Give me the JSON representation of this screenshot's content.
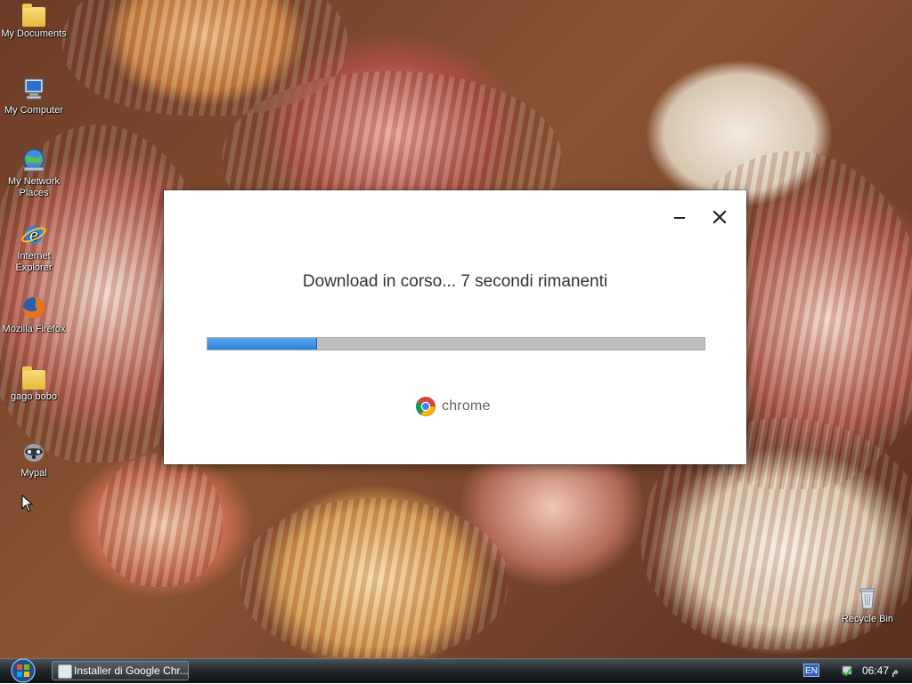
{
  "desktop": {
    "icons": [
      {
        "label": "My Documents",
        "icon": "folder-documents-icon"
      },
      {
        "label": "My Computer",
        "icon": "computer-icon"
      },
      {
        "label": "My Network Places",
        "icon": "network-globe-icon"
      },
      {
        "label": "Internet Explorer",
        "icon": "internet-explorer-icon"
      },
      {
        "label": "Mozilla Firefox",
        "icon": "firefox-icon"
      },
      {
        "label": "gago bobo",
        "icon": "folder-icon"
      },
      {
        "label": "Mypal",
        "icon": "mypal-raccoon-icon"
      },
      {
        "label": "Recycle Bin",
        "icon": "recycle-bin-icon"
      }
    ]
  },
  "dialog": {
    "status_text": "Download in corso... 7 secondi rimanenti",
    "progress": 0.22,
    "brand_label": "chrome",
    "colors": {
      "progress_fill": "#3b8de0",
      "progress_track": "#bdbdbd"
    }
  },
  "taskbar": {
    "task_label": "Installer di Google Chr...",
    "language": "EN",
    "clock": "06:47 م"
  }
}
